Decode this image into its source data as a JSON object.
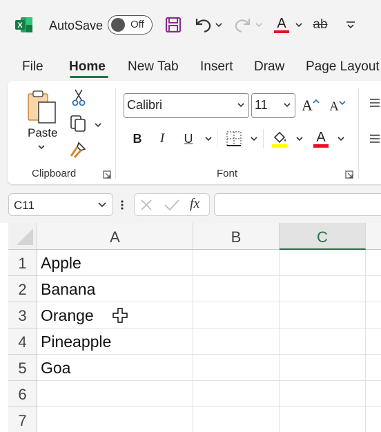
{
  "titlebar": {
    "autosave_label": "AutoSave",
    "autosave_state": "Off"
  },
  "tabs": [
    {
      "label": "File"
    },
    {
      "label": "Home",
      "active": true
    },
    {
      "label": "New Tab"
    },
    {
      "label": "Insert"
    },
    {
      "label": "Draw"
    },
    {
      "label": "Page Layout"
    }
  ],
  "ribbon": {
    "clipboard": {
      "paste_label": "Paste",
      "group_label": "Clipboard"
    },
    "font": {
      "font_name": "Calibri",
      "font_size": "11",
      "bold": "B",
      "italic": "I",
      "underline": "U",
      "grow": "A",
      "shrink": "A",
      "font_color_letter": "A",
      "group_label": "Font"
    }
  },
  "formula_bar": {
    "name_box": "C11",
    "fx_label": "fx",
    "formula": ""
  },
  "sheet": {
    "columns": [
      "A",
      "B",
      "C"
    ],
    "selected_column": "C",
    "rows": [
      {
        "num": "1",
        "a": "Apple",
        "b": "",
        "c": ""
      },
      {
        "num": "2",
        "a": "Banana",
        "b": "",
        "c": ""
      },
      {
        "num": "3",
        "a": "Orange",
        "b": "",
        "c": ""
      },
      {
        "num": "4",
        "a": "Pineapple",
        "b": "",
        "c": ""
      },
      {
        "num": "5",
        "a": "Goa",
        "b": "",
        "c": ""
      },
      {
        "num": "6",
        "a": "",
        "b": "",
        "c": ""
      },
      {
        "num": "7",
        "a": "",
        "b": "",
        "c": ""
      }
    ]
  },
  "colors": {
    "accent": "#217346",
    "font_color_bar": "#e81123",
    "highlight_bar": "#ffff00",
    "save_icon": "#8e2c8e"
  }
}
